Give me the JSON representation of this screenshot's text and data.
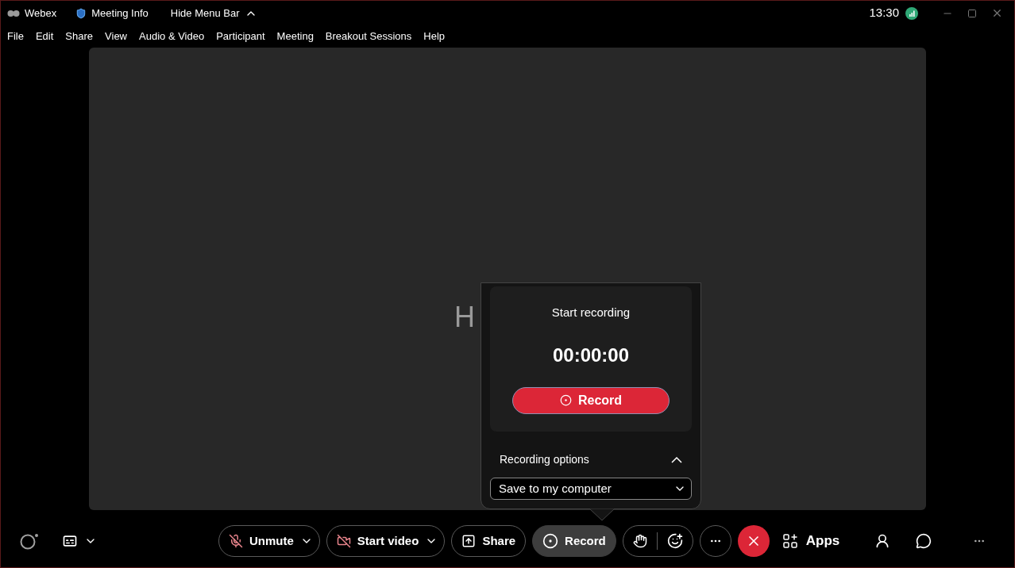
{
  "title_bar": {
    "app_name": "Webex",
    "meeting_info": "Meeting Info",
    "hide_menu_bar": "Hide Menu Bar",
    "time": "13:30"
  },
  "menu_bar": [
    "File",
    "Edit",
    "Share",
    "View",
    "Audio & Video",
    "Participant",
    "Meeting",
    "Breakout Sessions",
    "Help"
  ],
  "stage": {
    "partial_text": "H"
  },
  "recording_popover": {
    "heading": "Start recording",
    "timer": "00:00:00",
    "record_button": "Record",
    "options_label": "Recording options",
    "options_expanded": true,
    "save_location": "Save to my computer"
  },
  "toolbar": [
    {
      "kind": "split",
      "label": "Unmute",
      "selected": false
    },
    {
      "kind": "split",
      "label": "Start video",
      "selected": false
    },
    {
      "kind": "pill",
      "label": "Share",
      "selected": false
    },
    {
      "kind": "pill",
      "label": "Record",
      "selected": true
    },
    {
      "kind": "reactions"
    },
    {
      "kind": "more"
    },
    {
      "kind": "leave"
    },
    {
      "kind": "plain",
      "label": "Apps"
    }
  ]
}
